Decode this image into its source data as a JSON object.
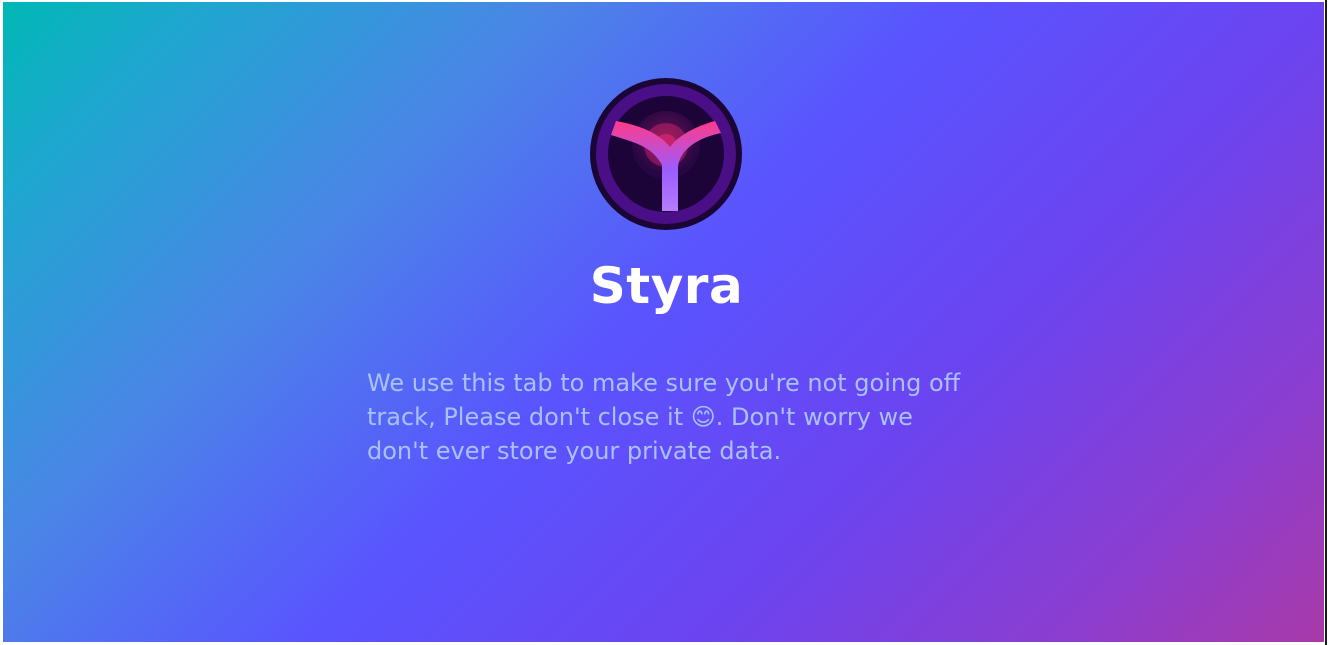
{
  "app": {
    "name": "Styra"
  },
  "main": {
    "message_part1": "We use this tab to make sure you're not going off track, Please don't close it ",
    "emoji": "😊",
    "message_part2": ". Don't worry we don't ever store your private data."
  },
  "colors": {
    "gradient_start": "#00b8b6",
    "gradient_mid": "#5a54ff",
    "gradient_end": "#a83aa8",
    "title": "#ffffff",
    "message": "#a9c1ff"
  },
  "icons": {
    "logo": "styra-logo-icon"
  }
}
